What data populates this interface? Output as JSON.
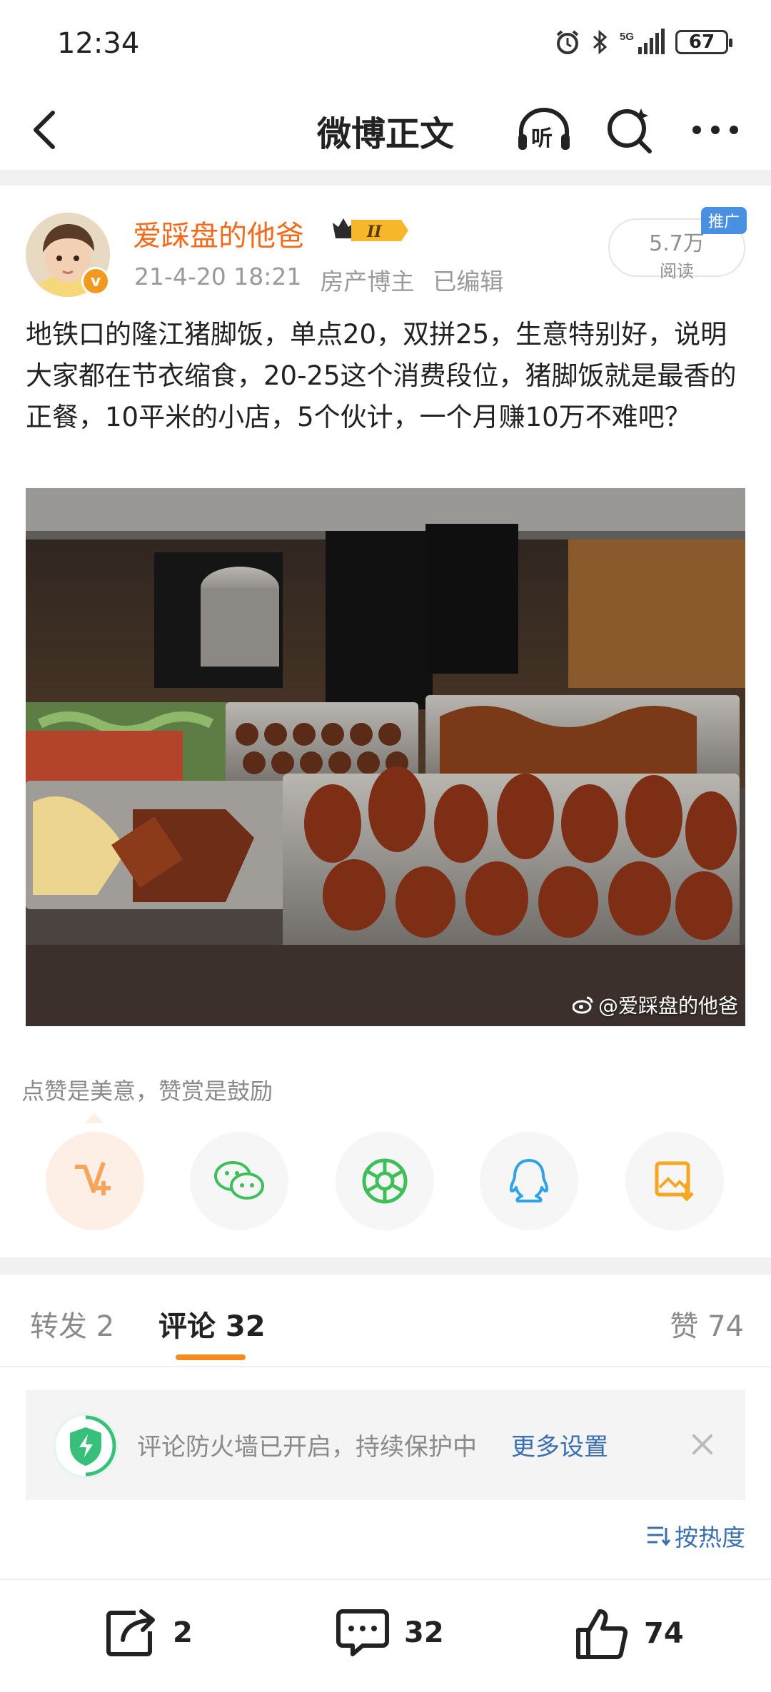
{
  "status_bar": {
    "time": "12:34",
    "battery": "67"
  },
  "nav": {
    "title": "微博正文"
  },
  "post": {
    "author": "爱踩盘的他爸",
    "badge_text": "II",
    "verified_mark": "v",
    "date": "21-4-20 18:21",
    "role": "房产博主",
    "edited": "已编辑",
    "reads": "5.7万",
    "reads_label": "阅读",
    "promo": "推广",
    "text": "地铁口的隆江猪脚饭，单点20，双拼25，生意特别好，说明大家都在节衣缩食，20-25这个消费段位，猪脚饭就是最香的正餐，10平米的小店，5个伙计，一个月赚10万不难吧？",
    "image_watermark": "@爱踩盘的他爸"
  },
  "tip": "点赞是美意，赞赏是鼓励",
  "share_buttons": [
    {
      "name": "reward-icon",
      "color": "#f5a65b"
    },
    {
      "name": "wechat-icon",
      "color": "#3fbf5a"
    },
    {
      "name": "moments-icon",
      "color": "#3fbf5a"
    },
    {
      "name": "qq-icon",
      "color": "#2fa3e6"
    },
    {
      "name": "save-image-icon",
      "color": "#f5a623"
    }
  ],
  "tabs": {
    "repost": "转发 2",
    "comments": "评论 32",
    "likes": "赞 74"
  },
  "notice": {
    "text": "评论防火墙已开启，持续保护中",
    "link": "更多设置"
  },
  "sort": {
    "label": "按热度"
  },
  "bottom": {
    "repost_count": "2",
    "comment_count": "32",
    "like_count": "74"
  },
  "colors": {
    "accent": "#f26b1d",
    "link": "#3a6fb0",
    "tab_indicator": "#f58a1f"
  }
}
